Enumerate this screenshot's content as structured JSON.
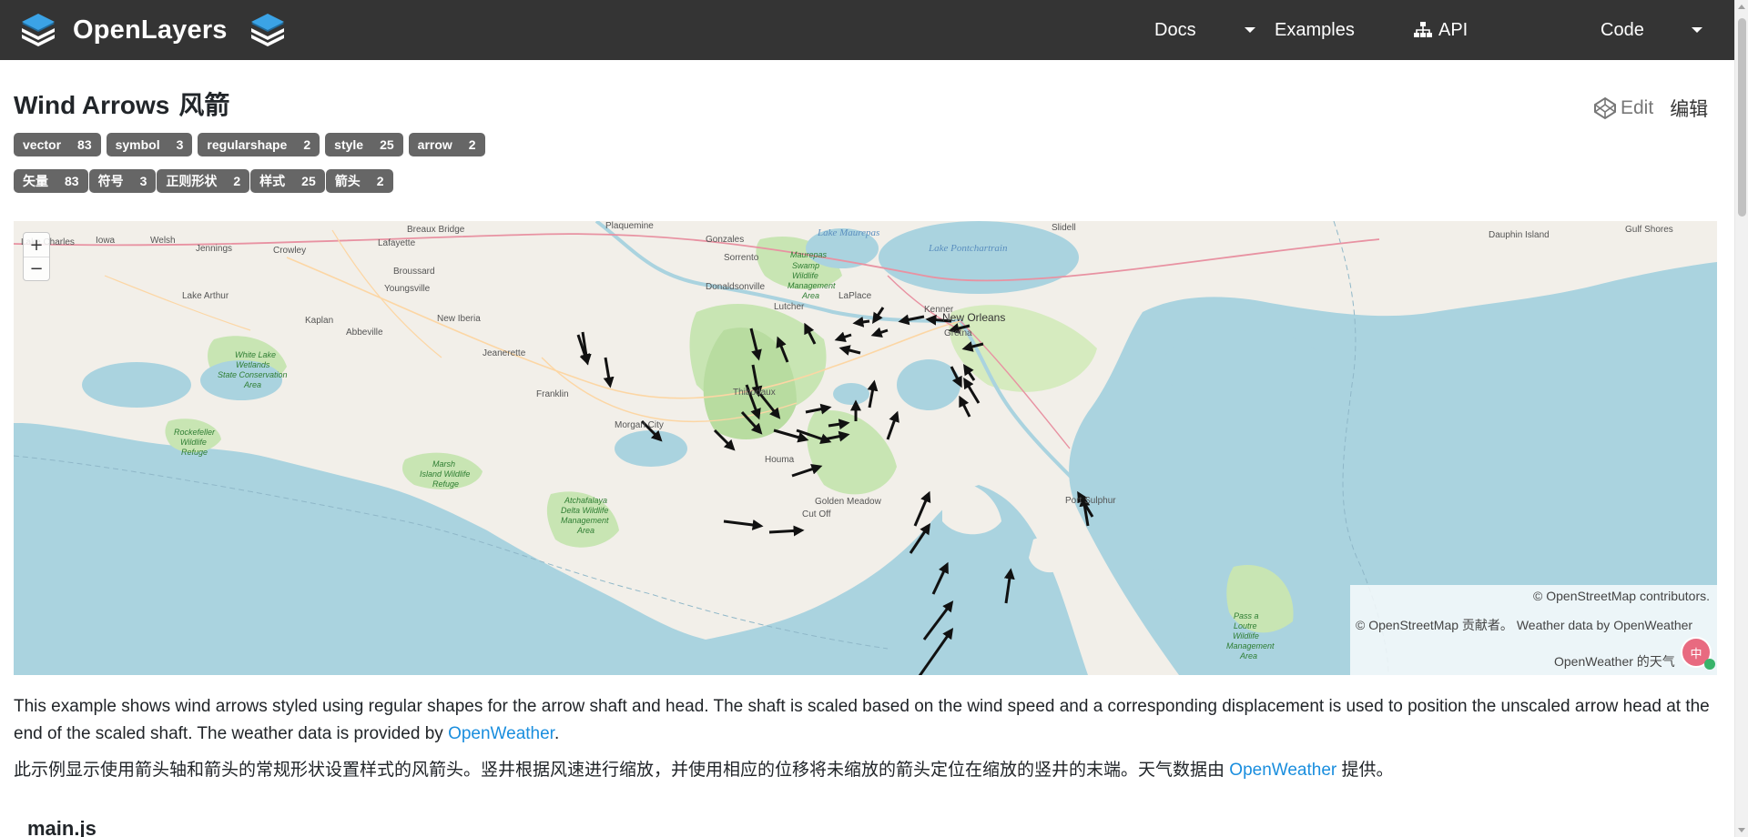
{
  "nav": {
    "brand_left": "OpenLayers",
    "docs": "Docs",
    "examples": "Examples",
    "api": "API",
    "code": "Code"
  },
  "page": {
    "title": "Wind Arrows",
    "title_zh": "风箭",
    "edit": "Edit",
    "edit_zh": "编辑"
  },
  "tags": [
    {
      "label": "vector",
      "count": "83"
    },
    {
      "label": "symbol",
      "count": "3"
    },
    {
      "label": "regularshape",
      "count": "2"
    },
    {
      "label": "style",
      "count": "25"
    },
    {
      "label": "arrow",
      "count": "2"
    }
  ],
  "tags_zh": [
    {
      "label": "矢量",
      "count": "83"
    },
    {
      "label": "符号",
      "count": "3"
    },
    {
      "label": "正则形状",
      "count": "2"
    },
    {
      "label": "样式",
      "count": "25"
    },
    {
      "label": "箭头",
      "count": "2"
    }
  ],
  "map": {
    "zoom_in": "+",
    "zoom_out": "−",
    "attribution_1": "© OpenStreetMap contributors.",
    "attribution_2_prefix": "© OpenStreetMap 贡献者。 Weather data by ",
    "attribution_2_link": "OpenWeather",
    "attribution_3_link": "OpenWeather",
    "attribution_3_suffix": " 的天气",
    "attribution_toggle": "中",
    "labels": {
      "lake_pontchartrain": "Lake Pontchartrain",
      "new_orleans": "New Orleans",
      "kenner": "Kenner",
      "gretna": "Gretna",
      "houma": "Houma",
      "thibodaux": "Thibodaux",
      "morgan_city": "Morgan City",
      "franklin": "Franklin",
      "jeanerette": "Jeanerette",
      "new_iberia": "New Iberia",
      "abbeville": "Abbeville",
      "kaplan": "Kaplan",
      "lafayette": "Lafayette",
      "crowley": "Crowley",
      "jennings": "Jennings",
      "lake_charles": "Lake Charles",
      "iowa": "Iowa",
      "welsh": "Welsh",
      "breaux_bridge": "Breaux Bridge",
      "broussard": "Broussard",
      "youngsville": "Youngsville",
      "lake_arthur": "Lake Arthur",
      "plaquemine": "Plaquemine",
      "gonzales": "Gonzales",
      "sorrento": "Sorrento",
      "donaldsonville": "Donaldsonville",
      "lutcher": "Lutcher",
      "laplace": "LaPlace",
      "slidell": "Slidell",
      "dauphin_island": "Dauphin Island",
      "gulf_shores": "Gulf Shores",
      "lake_maurepas": "Lake Maurepas",
      "maurepas_swamp": "Maurepas Swamp Wildlife Management Area",
      "white_lake": "White Lake Wetlands State Conservation Area",
      "rockefeller": "Rockefeller Wildlife Refuge",
      "marsh_island": "Marsh Island Wildlife Refuge",
      "atchafalaya": "Atchafalaya Delta Wildlife Management Area",
      "pass_a_loutre": "Pass a Loutre Wildlife Management Area",
      "port_sulphur": "Port Sulphur",
      "cut_off": "Cut Off",
      "golden_meadow": "Golden Meadow"
    }
  },
  "description": {
    "en_text": "This example shows wind arrows styled using regular shapes for the arrow shaft and head. The shaft is scaled based on the wind speed and a corresponding displacement is used to position the unscaled arrow head at the end of the scaled shaft. The weather data is provided by ",
    "en_link": "OpenWeather",
    "en_end": ".",
    "zh_text": "此示例显示使用箭头轴和箭头的常规形状设置样式的风箭头。竖井根据风速进行缩放，并使用相应的位移将未缩放的箭头定位在缩放的竖井的末端。天气数据由 ",
    "zh_link": "OpenWeather",
    "zh_end": " 提供。"
  },
  "code_heading": "main.js",
  "colors": {
    "navbar": "#343434",
    "tag": "#666666",
    "link": "#1a8ede",
    "water": "#aad3df",
    "land": "#f2efe9",
    "park": "#c8e5b3"
  }
}
